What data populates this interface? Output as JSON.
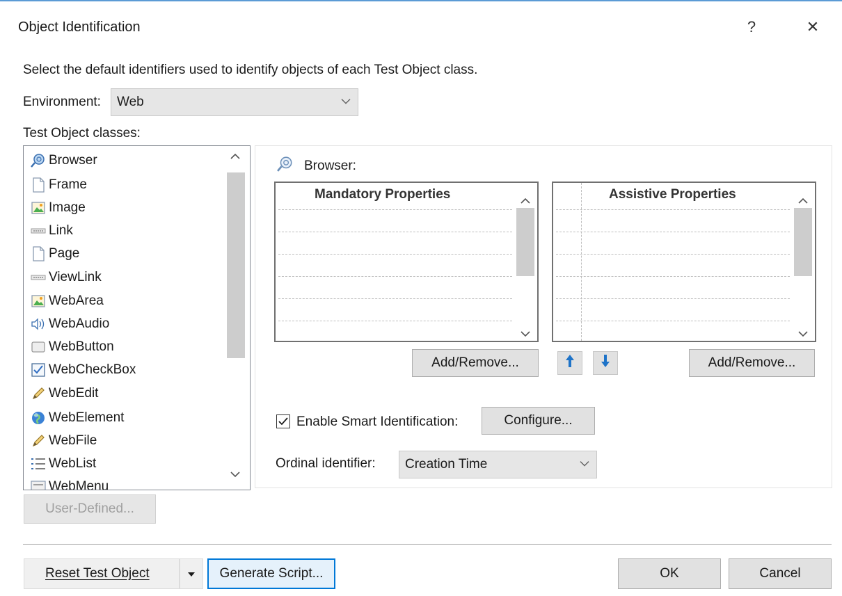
{
  "dialog": {
    "title": "Object Identification",
    "help_glyph": "?",
    "close_glyph": "✕"
  },
  "description": "Select the default identifiers used to identify objects of each Test Object class.",
  "environment": {
    "label": "Environment:",
    "value": "Web"
  },
  "classes": {
    "label": "Test Object classes:",
    "items": [
      {
        "label": "Browser",
        "icon": "browser-icon"
      },
      {
        "label": "Frame",
        "icon": "page-icon"
      },
      {
        "label": "Image",
        "icon": "image-icon"
      },
      {
        "label": "Link",
        "icon": "link-icon"
      },
      {
        "label": "Page",
        "icon": "page-icon"
      },
      {
        "label": "ViewLink",
        "icon": "link-icon"
      },
      {
        "label": "WebArea",
        "icon": "image-icon"
      },
      {
        "label": "WebAudio",
        "icon": "speaker-icon"
      },
      {
        "label": "WebButton",
        "icon": "button-icon"
      },
      {
        "label": "WebCheckBox",
        "icon": "checkbox-icon"
      },
      {
        "label": "WebEdit",
        "icon": "pencil-icon"
      },
      {
        "label": "WebElement",
        "icon": "globe-icon"
      },
      {
        "label": "WebFile",
        "icon": "pencil-icon"
      },
      {
        "label": "WebList",
        "icon": "list-icon"
      },
      {
        "label": "WebMenu",
        "icon": "menu-icon"
      }
    ],
    "user_defined_label": "User-Defined..."
  },
  "details": {
    "selected_class": "Browser:",
    "mandatory_header": "Mandatory Properties",
    "assistive_header": "Assistive Properties",
    "add_remove_label": "Add/Remove...",
    "smart_id_label": "Enable Smart Identification:",
    "smart_id_checked": true,
    "configure_label": "Configure...",
    "ordinal_label": "Ordinal identifier:",
    "ordinal_value": "Creation Time"
  },
  "footer": {
    "reset_label": "Reset Test Object",
    "generate_label": "Generate Script...",
    "ok_label": "OK",
    "cancel_label": "Cancel"
  },
  "colors": {
    "accent": "#0078d7",
    "arrow_blue": "#1e73c8",
    "button_bg": "#e1e1e1"
  }
}
